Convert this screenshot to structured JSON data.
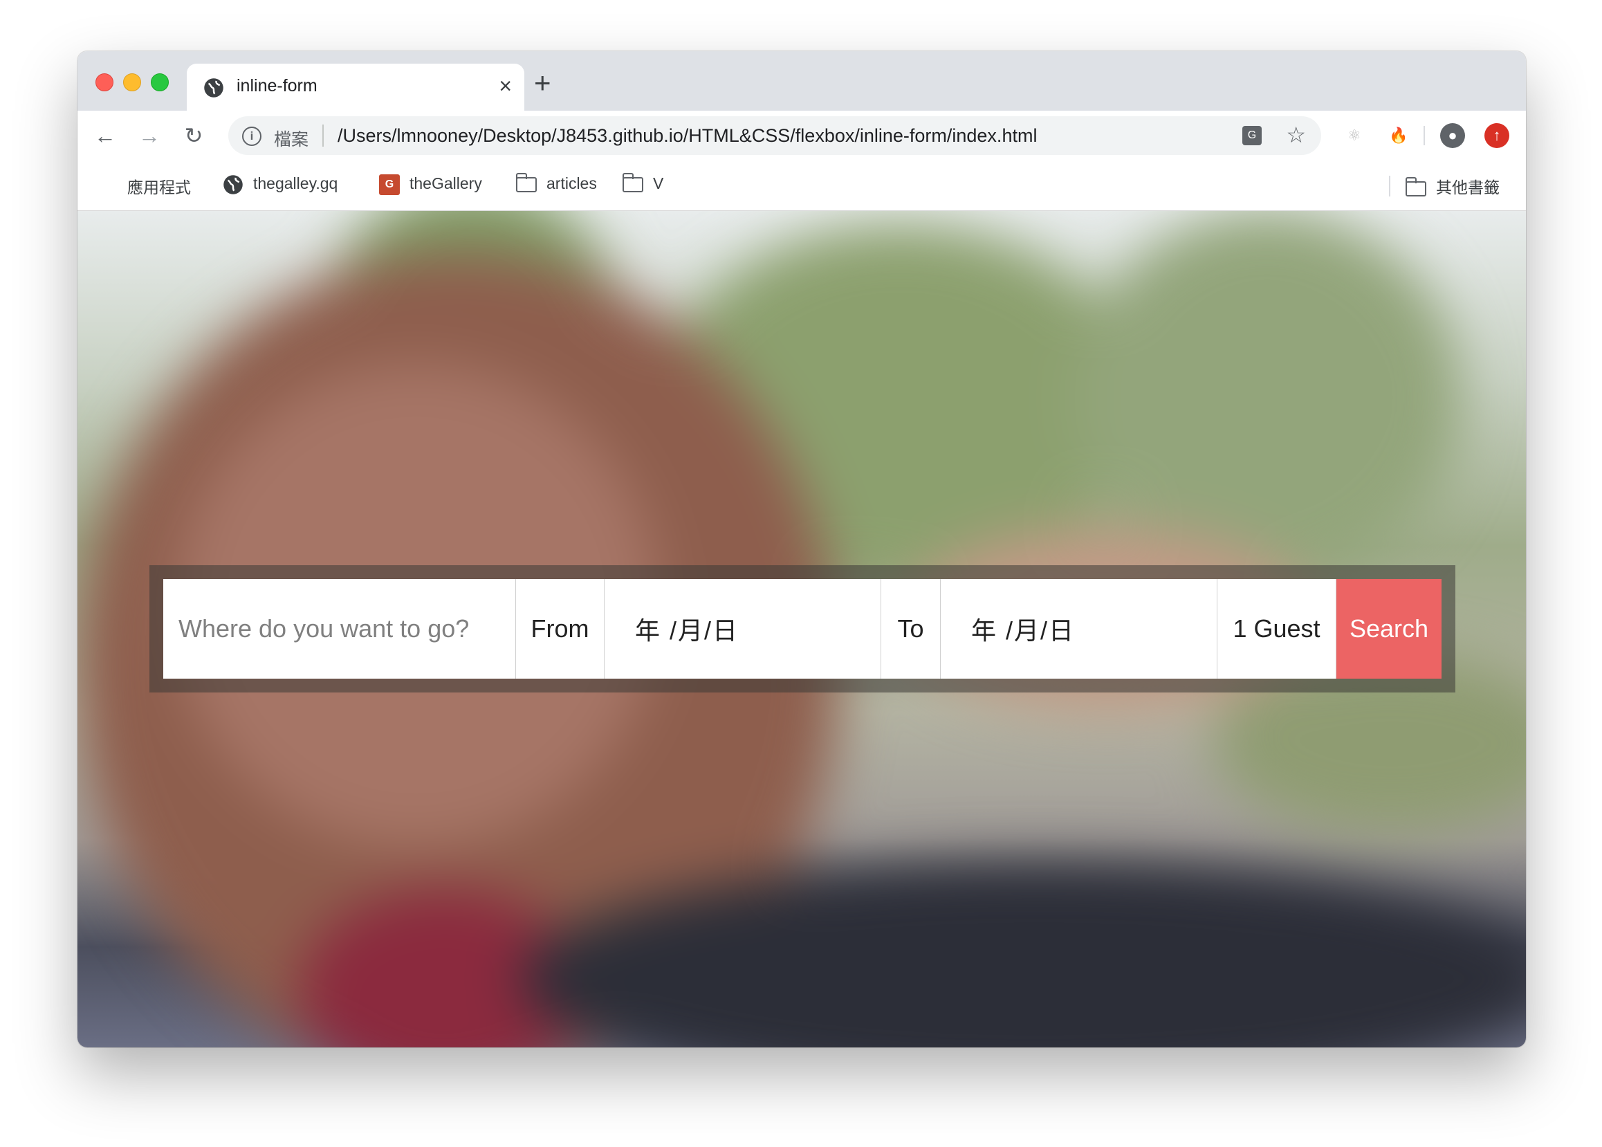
{
  "browser": {
    "tab_title": "inline-form",
    "new_tab": "+",
    "close": "×",
    "scheme_label": "檔案",
    "url": "/Users/lmnooney/Desktop/J8453.github.io/HTML&CSS/flexbox/inline-form/index.html"
  },
  "bookmarks": {
    "apps": "應用程式",
    "galley": "thegalley.gq",
    "gallery": "theGallery",
    "articles": "articles",
    "v": "V",
    "other": "其他書籤"
  },
  "form": {
    "where_placeholder": "Where do you want to go?",
    "from_label": "From",
    "from_date": "年 /月/日",
    "to_label": "To",
    "to_date": "年 /月/日",
    "guests": "1 Guest",
    "search_label": "Search"
  },
  "colors": {
    "search_button": "#ec6464",
    "tab_strip": "#dee1e6"
  },
  "icons": [
    "globe-icon",
    "close-icon",
    "back-icon",
    "forward-icon",
    "reload-icon",
    "info-icon",
    "translate-icon",
    "star-icon",
    "react-icon",
    "fire-icon",
    "profile-icon",
    "update-icon",
    "apps-icon",
    "folder-icon"
  ]
}
